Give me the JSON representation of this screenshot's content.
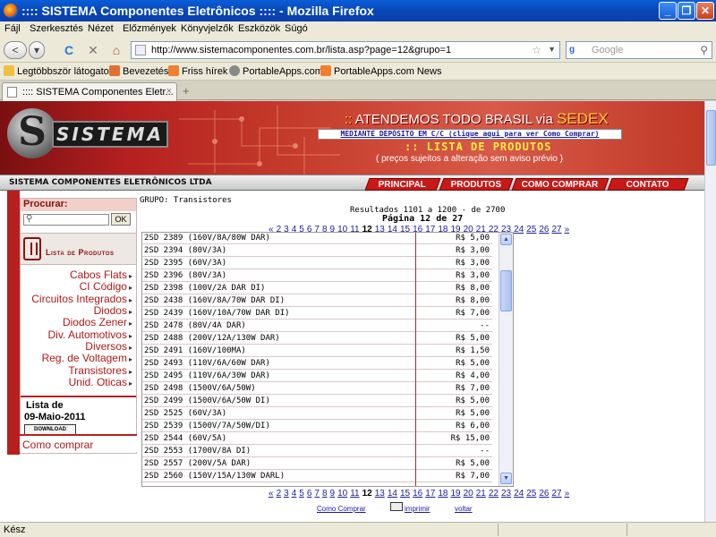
{
  "window": {
    "title": ":::: SISTEMA Componentes Eletrônicos :::: - Mozilla Firefox",
    "minimize": "_",
    "maximize": "❐",
    "close": "✕"
  },
  "menu": [
    "Fájl",
    "Szerkesztés",
    "Nézet",
    "Előzmények",
    "Könyvjelzők",
    "Eszközök",
    "Súgó"
  ],
  "nav": {
    "back": "<",
    "forward": "▾",
    "reload": "C",
    "stop": "✕",
    "home": "⌂",
    "url": "http://www.sistemacomponentes.com.br/lista.asp?page=12&grupo=1",
    "search_engine": "g",
    "search_placeholder": "Google"
  },
  "bookmarks": [
    "Legtöbbször látogatott",
    "Bevezetés",
    "Friss hírek",
    "PortableApps.com",
    "PortableApps.com News"
  ],
  "tab": {
    "label": ":::: SISTEMA Componentes Eletr...",
    "close": "×",
    "new": "+"
  },
  "banner": {
    "logo_letter": "S",
    "logo_word": "SISTEMA",
    "headline_prefix": "::",
    "headline_text": "ATENDEMOS TODO BRASIL via",
    "headline_sedex": "SEDEX",
    "deposit": "MEDIANTE DEPÓSITO EM C/C (clique aqui para ver Como Comprar)",
    "lista": ":: LISTA DE PRODUTOS",
    "precos": "( preços sujeitos a alteração sem aviso prévio )",
    "company": "SISTEMA COMPONENTES ELETRÔNICOS LTDA",
    "links": [
      "PRINCIPAL",
      "PRODUTOS",
      "COMO COMPRAR",
      "CONTATO"
    ]
  },
  "sidebar": {
    "procurar": "Procurar:",
    "ok": "OK",
    "lista_produtos": "Lista de Produtos",
    "categories": [
      "Cabos Flats",
      "CI Código",
      "Circuitos Integrados",
      "Diodos",
      "Diodos Zener",
      "Div. Automotivos",
      "Diversos",
      "Reg. de Voltagem",
      "Transistores",
      "Unid. Oticas"
    ],
    "lista_de": "Lista de",
    "date": "09-Maio-2011",
    "download": "DOWNLOAD",
    "como_comprar": "Como comprar"
  },
  "main": {
    "grupo": "GRUPO: Transistores",
    "resultados": "Resultados 1101 a 1200 - de 2700",
    "pagina": "Página 12 de 27",
    "pager_prev": "«",
    "pager_next": "»",
    "pages_before": [
      "2",
      "3",
      "4",
      "5",
      "6",
      "7",
      "8",
      "9",
      "10",
      "11"
    ],
    "current_page": "12",
    "pages_after": [
      "13",
      "14",
      "15",
      "16",
      "17",
      "18",
      "19",
      "20",
      "21",
      "22",
      "23",
      "24",
      "25",
      "26",
      "27"
    ],
    "products": [
      {
        "name": "2SD 2389 (160V/8A/80W DAR)",
        "price": "R$ 5,00"
      },
      {
        "name": "2SD 2394 (80V/3A)",
        "price": "R$ 3,00"
      },
      {
        "name": "2SD 2395 (60V/3A)",
        "price": "R$ 3,00"
      },
      {
        "name": "2SD 2396 (80V/3A)",
        "price": "R$ 3,00"
      },
      {
        "name": "2SD 2398 (100V/2A DAR DI)",
        "price": "R$ 8,00"
      },
      {
        "name": "2SD 2438 (160V/8A/70W DAR DI)",
        "price": "R$ 8,00"
      },
      {
        "name": "2SD 2439 (160V/10A/70W DAR DI)",
        "price": "R$ 7,00"
      },
      {
        "name": "2SD 2478 (80V/4A DAR)",
        "price": "--"
      },
      {
        "name": "2SD 2488 (200V/12A/130W DAR)",
        "price": "R$ 5,00"
      },
      {
        "name": "2SD 2491 (160V/100MA)",
        "price": "R$ 1,50"
      },
      {
        "name": "2SD 2493 (110V/6A/60W DAR)",
        "price": "R$ 5,00"
      },
      {
        "name": "2SD 2495 (110V/6A/30W DAR)",
        "price": "R$ 4,00"
      },
      {
        "name": "2SD 2498 (1500V/6A/50W)",
        "price": "R$ 7,00"
      },
      {
        "name": "2SD 2499 (1500V/6A/50W DI)",
        "price": "R$ 5,00"
      },
      {
        "name": "2SD 2525 (60V/3A)",
        "price": "R$ 5,00"
      },
      {
        "name": "2SD 2539 (1500V/7A/50W/DI)",
        "price": "R$ 6,00"
      },
      {
        "name": "2SD 2544 (60V/5A)",
        "price": "R$ 15,00"
      },
      {
        "name": "2SD 2553 (1700V/8A DI)",
        "price": "--"
      },
      {
        "name": "2SD 2557 (200V/5A DAR)",
        "price": "R$ 5,00"
      },
      {
        "name": "2SD 2560 (150V/15A/130W DARL)",
        "price": "R$ 7,00"
      }
    ],
    "como_comprar": "Como Comprar",
    "imprimir": "imprimir",
    "voltar": "voltar"
  },
  "status": "Kész"
}
